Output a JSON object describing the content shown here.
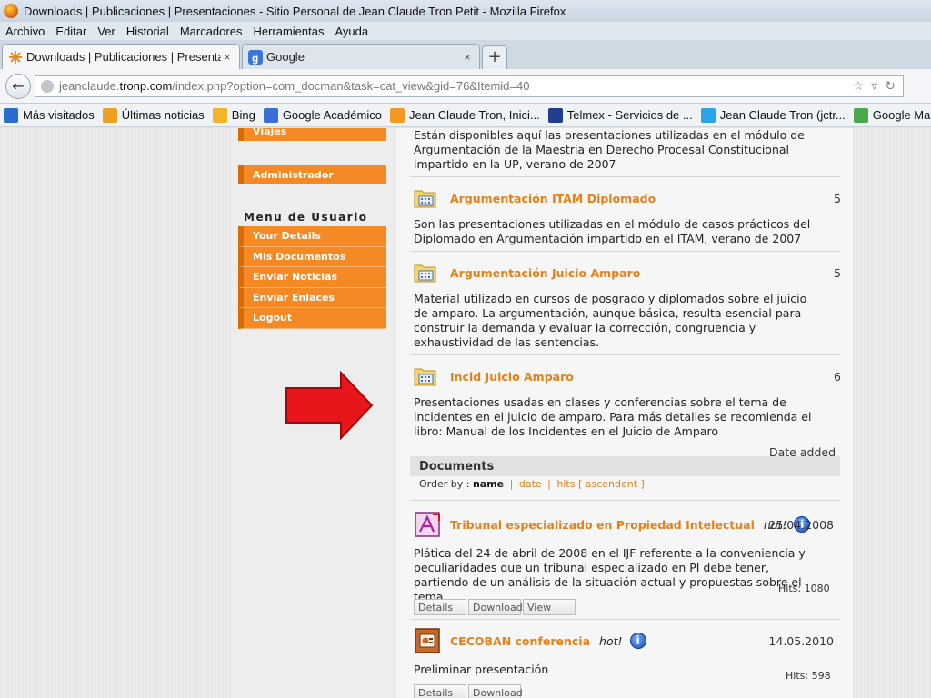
{
  "window": {
    "title": "Downloads | Publicaciones | Presentaciones - Sitio Personal de Jean Claude Tron Petit - Mozilla Firefox"
  },
  "menubar": [
    "Archivo",
    "Editar",
    "Ver",
    "Historial",
    "Marcadores",
    "Herramientas",
    "Ayuda"
  ],
  "tabs": [
    {
      "label": "Downloads | Publicaciones | Presenta...",
      "close": "×"
    },
    {
      "label": "Google",
      "close": "×"
    }
  ],
  "newtab": "+",
  "navbar": {
    "url_host": "jeanclaude.tronp.com",
    "url_path": "/index.php?option=com_docman&task=cat_view&gid=76&Itemid=40",
    "url_prefix": "jeanclaude."
  },
  "bookmarks": [
    {
      "label": "Más visitados",
      "color": "#2a6bd0"
    },
    {
      "label": "Últimas noticias",
      "color": "#f0a020"
    },
    {
      "label": "Bing",
      "color": "#f2b52a"
    },
    {
      "label": "Google Académico",
      "color": "#3a6fd8"
    },
    {
      "label": "Jean Claude Tron, Inici...",
      "color": "#f49a22"
    },
    {
      "label": "Telmex - Servicios de ...",
      "color": "#1f3f8c"
    },
    {
      "label": "Jean Claude Tron (jctr...",
      "color": "#2aa4e8"
    },
    {
      "label": "Google Maps",
      "color": "#4aa84a"
    }
  ],
  "sidebar": {
    "viajes": "Viajes",
    "administrador": "Administrador",
    "menu_heading": "Menu de Usuario",
    "menu_items": [
      "Your Details",
      "Mis Documentos",
      "Enviar Noticias",
      "Enviar Enlaces",
      "Logout"
    ]
  },
  "content": {
    "top_desc": "Están disponibles aquí las presentaciones utilizadas en el módulo de Argumentación de la Maestría en Derecho Procesal Constitucional impartido en la UP, verano de 2007",
    "categories": [
      {
        "title": "Argumentación ITAM Diplomado",
        "count": "5",
        "desc": "Son las presentaciones utilizadas en el módulo de casos prácticos del Diplomado en Argumentación impartido en el ITAM, verano de 2007"
      },
      {
        "title": "Argumentación Juicio Amparo",
        "count": "5",
        "desc": "Material utilizado en cursos de posgrado y diplomados sobre el juicio de amparo. La argumentación, aunque básica, resulta esencial para construir la demanda y evaluar la corrección, congruencia y exhaustividad de las sentencias."
      },
      {
        "title": "Incid Juicio Amparo",
        "count": "6",
        "desc": "Presentaciones usadas en clases y conferencias sobre el tema de incidentes en el juicio de amparo. Para más detalles se recomienda el libro: Manual de los Incidentes en el Juicio de Amparo"
      }
    ],
    "date_added": "Date added",
    "documents_heading": "Documents",
    "orderby": {
      "label": "Order by :",
      "name": "name",
      "date": "date",
      "hits": "hits",
      "ascendent": "[ ascendent ]"
    },
    "documents": [
      {
        "title": "Tribunal especializado en Propiedad Intelectual",
        "hot": "hot!",
        "date": "25.04.2008",
        "desc": "Plática del 24 de abril de 2008 en el IJF referente a la conveniencia y peculiaridades que un tribunal especializado en PI debe tener, partiendo de un análisis de la situación actual y propuestas sobre el tema.",
        "hits": "Hits: 1080",
        "buttons": [
          "Details",
          "Download",
          "View"
        ]
      },
      {
        "title": "CECOBAN conferencia",
        "hot": "hot!",
        "date": "14.05.2010",
        "desc": "Preliminar presentación",
        "hits": "Hits: 598",
        "buttons": [
          "Details",
          "Download"
        ]
      }
    ]
  },
  "colors": {
    "accent_orange": "#e8801a",
    "menu_orange": "#f58a24",
    "arrow_red": "#e8161b"
  }
}
